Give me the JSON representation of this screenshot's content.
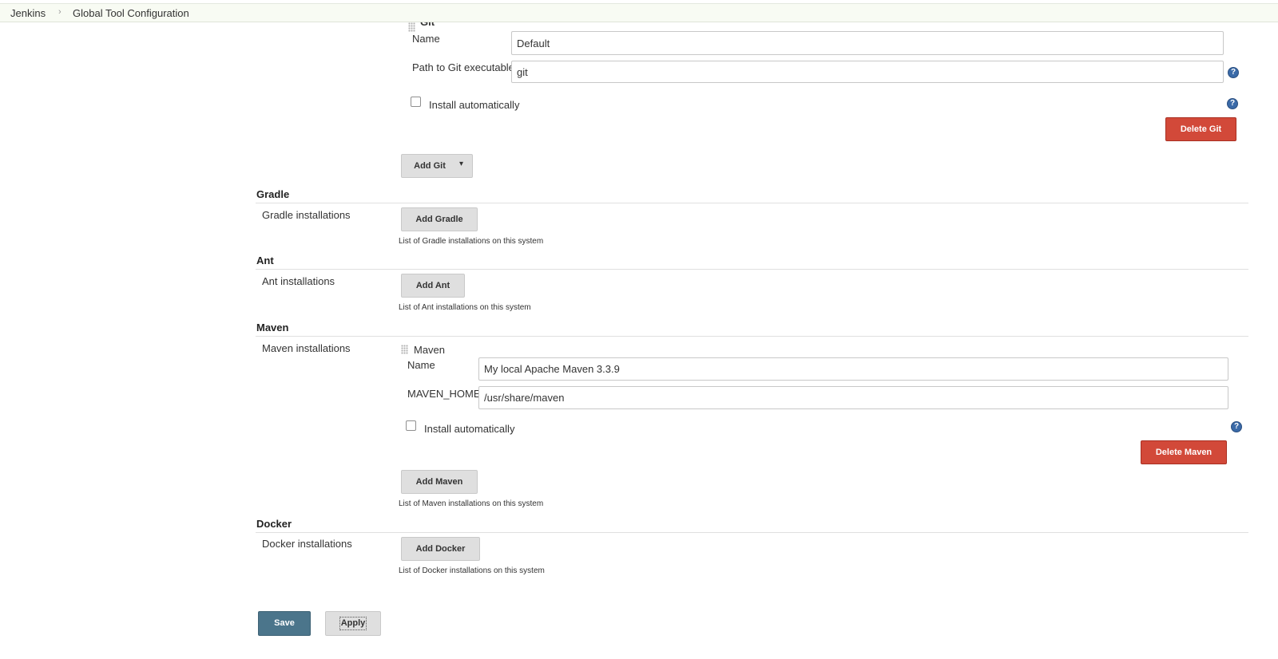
{
  "breadcrumb": {
    "root": "Jenkins",
    "separator": "›",
    "current": "Global Tool Configuration"
  },
  "git": {
    "header": "Git",
    "name_label": "Name",
    "name_value": "Default",
    "path_label": "Path to Git executable",
    "path_value": "git",
    "install_label": "Install automatically",
    "install_checked": false,
    "delete_label": "Delete Git",
    "add_label": "Add Git",
    "add_arrow": "▾"
  },
  "gradle": {
    "title": "Gradle",
    "installations_label": "Gradle installations",
    "add_label": "Add Gradle",
    "description": "List of Gradle installations on this system"
  },
  "ant": {
    "title": "Ant",
    "installations_label": "Ant installations",
    "add_label": "Add Ant",
    "description": "List of Ant installations on this system"
  },
  "maven": {
    "title": "Maven",
    "installations_label": "Maven installations",
    "item_header": "Maven",
    "name_label": "Name",
    "name_value": "My local Apache Maven 3.3.9",
    "home_label": "MAVEN_HOME",
    "home_value": "/usr/share/maven",
    "install_label": "Install automatically",
    "install_checked": false,
    "delete_label": "Delete Maven",
    "add_label": "Add Maven",
    "description": "List of Maven installations on this system"
  },
  "docker": {
    "title": "Docker",
    "installations_label": "Docker installations",
    "add_label": "Add Docker",
    "description": "List of Docker installations on this system"
  },
  "footer": {
    "save_label": "Save",
    "apply_label": "Apply"
  },
  "help_glyph": "?",
  "colors": {
    "delete": "#d24939",
    "save": "#4b758b",
    "help": "#3a6aa8"
  }
}
